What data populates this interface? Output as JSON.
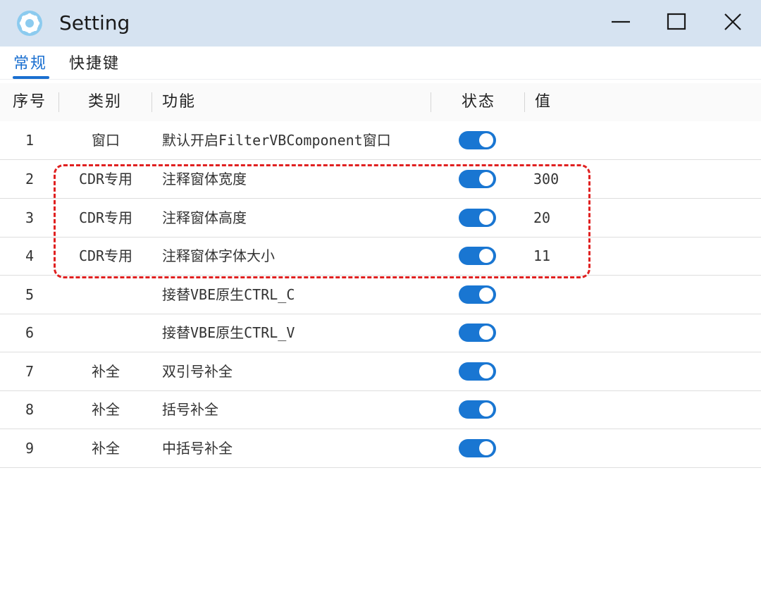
{
  "window": {
    "title": "Setting",
    "app_icon": "gear-icon",
    "controls": [
      "minimize-icon",
      "maximize-icon",
      "close-icon"
    ]
  },
  "tabs": [
    {
      "label": "常规",
      "active": true
    },
    {
      "label": "快捷键",
      "active": false
    }
  ],
  "table": {
    "headers": {
      "index": "序号",
      "category": "类别",
      "function": "功能",
      "status": "状态",
      "value": "值"
    },
    "rows": [
      {
        "index": "1",
        "category": "窗口",
        "function": "默认开启FilterVBComponent窗口",
        "enabled": true,
        "value": ""
      },
      {
        "index": "2",
        "category": "CDR专用",
        "function": "注释窗体宽度",
        "enabled": true,
        "value": "300"
      },
      {
        "index": "3",
        "category": "CDR专用",
        "function": "注释窗体高度",
        "enabled": true,
        "value": "20"
      },
      {
        "index": "4",
        "category": "CDR专用",
        "function": "注释窗体字体大小",
        "enabled": true,
        "value": "11"
      },
      {
        "index": "5",
        "category": "",
        "function": "接替VBE原生CTRL_C",
        "enabled": true,
        "value": ""
      },
      {
        "index": "6",
        "category": "",
        "function": "接替VBE原生CTRL_V",
        "enabled": true,
        "value": ""
      },
      {
        "index": "7",
        "category": "补全",
        "function": "双引号补全",
        "enabled": true,
        "value": ""
      },
      {
        "index": "8",
        "category": "补全",
        "function": "括号补全",
        "enabled": true,
        "value": ""
      },
      {
        "index": "9",
        "category": "补全",
        "function": "中括号补全",
        "enabled": true,
        "value": ""
      }
    ]
  },
  "colors": {
    "titlebar": "#d6e3f1",
    "accent": "#1a6fd0",
    "toggle_on": "#1976d2",
    "highlight_border": "#e02020"
  }
}
